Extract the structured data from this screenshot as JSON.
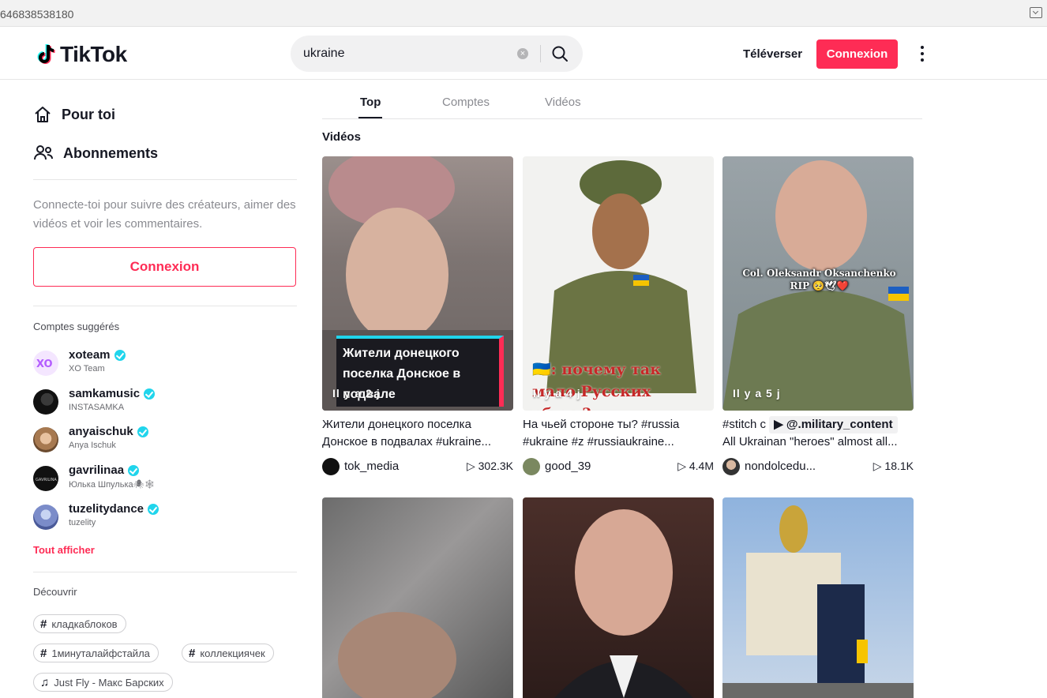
{
  "browser": {
    "url": "646838538180"
  },
  "header": {
    "logo_text": "TikTok",
    "search_value": "ukraine",
    "upload_label": "Téléverser",
    "login_label": "Connexion"
  },
  "sidebar": {
    "nav": [
      {
        "label": "Pour toi",
        "icon": "home-icon"
      },
      {
        "label": "Abonnements",
        "icon": "following-icon"
      }
    ],
    "login_prompt": "Connecte-toi pour suivre des créateurs, aimer des vidéos et voir les commentaires.",
    "login_button": "Connexion",
    "suggested_title": "Comptes suggérés",
    "accounts": [
      {
        "username": "xoteam",
        "nickname": "XO Team",
        "avatar_text": "XO"
      },
      {
        "username": "samkamusic",
        "nickname": "INSTASAMKA",
        "avatar_text": ""
      },
      {
        "username": "anyaischuk",
        "nickname": "Anya Ischuk",
        "avatar_text": ""
      },
      {
        "username": "gavrilinaa",
        "nickname": "Юлька Шпулька🕷🕸",
        "avatar_text": "GAVRILINA"
      },
      {
        "username": "tuzelitydance",
        "nickname": "tuzelity",
        "avatar_text": ""
      }
    ],
    "see_all": "Tout afficher",
    "discover_title": "Découvrir",
    "tags": [
      {
        "symbol": "#",
        "label": "кладкаблоков"
      },
      {
        "symbol": "#",
        "label": "1минуталайфстайла"
      },
      {
        "symbol": "#",
        "label": "коллекциячек"
      },
      {
        "symbol": "♫",
        "label": "Just Fly - Макс Барских"
      }
    ]
  },
  "main": {
    "tabs": [
      "Top",
      "Comptes",
      "Vidéos"
    ],
    "section_title": "Vidéos",
    "videos": [
      {
        "ago": "Il y a 2 j",
        "overlay": "Жители донецкого поселка Донское в подвале",
        "line1": "Жители донецкого поселка",
        "line2": "Донское в подвалах #ukraine...",
        "author": "tok_media",
        "views": "302.3K"
      },
      {
        "ago": "Il y a 4 j",
        "overlay": "🇺🇦: почему так мало Русских убито?",
        "line1": "На чьей стороне ты? #russia",
        "line2": "#ukraine #z #russiaukraine...",
        "author": "good_39",
        "views": "4.4M"
      },
      {
        "ago": "Il y a 5 j",
        "overlay": "Col. Oleksandr Oksanchenko RIP 🥺🕊❤️",
        "line1_prefix": "#stitch с",
        "line1_tag": "▶ @.military_content",
        "line2": "All Ukrainan \"heroes\" almost all...",
        "author": "nondolcedu...",
        "views": "18.1K"
      }
    ]
  },
  "colors": {
    "brand": "#fe2c55",
    "verified": "#20d5ec"
  }
}
